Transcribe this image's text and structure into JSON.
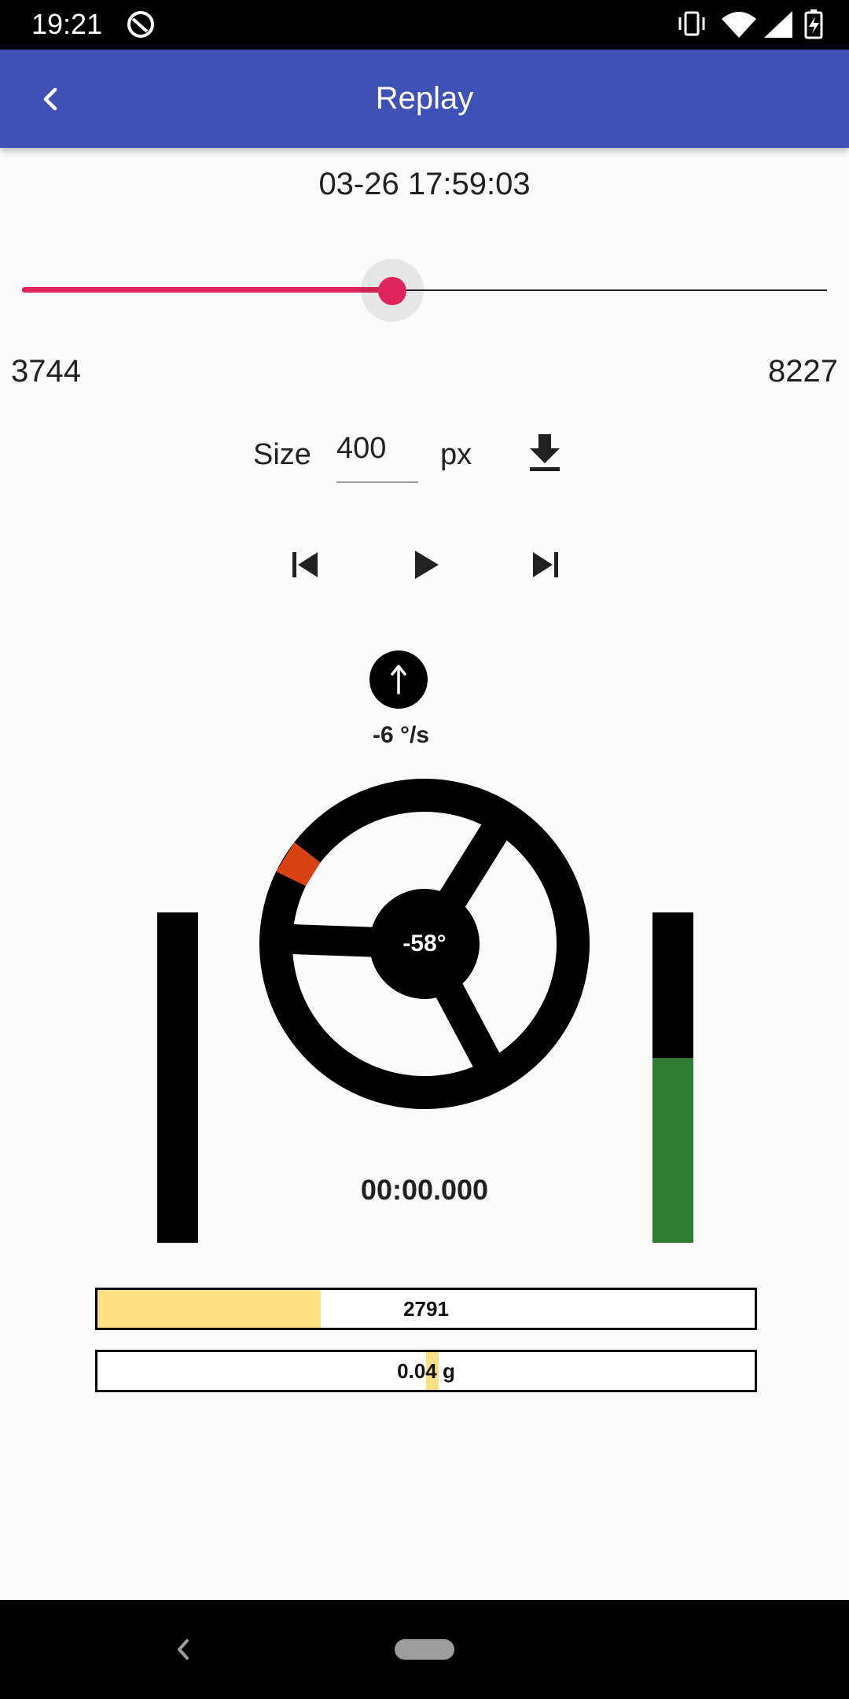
{
  "status_bar": {
    "time": "19:21",
    "icons": [
      "app-notification-icon",
      "vibrate-icon",
      "wifi-icon",
      "signal-icon",
      "battery-charging-icon"
    ]
  },
  "app_bar": {
    "title": "Replay",
    "back_icon": "chevron-left-icon",
    "color": "#3f51b5"
  },
  "timestamp": "03-26 17:59:03",
  "slider": {
    "min_label": "3744",
    "max_label": "8227",
    "position_fraction": 0.46,
    "color": "#e0245e"
  },
  "size": {
    "label": "Size",
    "value": "400",
    "unit": "px",
    "download_icon": "download-icon"
  },
  "playback": {
    "icons": [
      "skip-previous-icon",
      "play-icon",
      "skip-next-icon"
    ]
  },
  "rate": {
    "value": "-6 °/s",
    "icon": "arrow-up-icon"
  },
  "steering": {
    "angle_label": "-58°",
    "angle_deg": -58,
    "marker_color": "#d84315"
  },
  "side_bars": {
    "left_fill_fraction": 0,
    "right_fill_fraction": 0.56,
    "right_fill_color": "#2e7d32"
  },
  "elapsed": "00:00.000",
  "meters": [
    {
      "label": "2791",
      "fill_fraction": 0.34,
      "color": "#ffe082"
    },
    {
      "label": "0.04 g",
      "marker_fraction": 0.51,
      "color": "#ffe082"
    }
  ],
  "nav_bar": {
    "icons": [
      "back-icon",
      "home-pill-icon"
    ]
  }
}
